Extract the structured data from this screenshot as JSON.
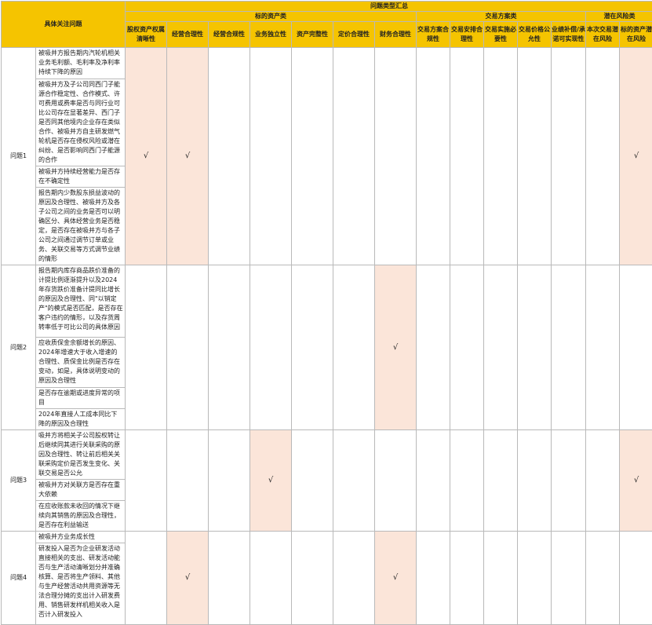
{
  "header": {
    "focus_issue": "具体关注问题",
    "summary": "问题类型汇总",
    "group_target_assets": "标的资产类",
    "group_transaction": "交易方案类",
    "group_risk": "潜在风险类"
  },
  "columns": [
    {
      "label": "股权资产权属清晰性",
      "group": "标的资产类"
    },
    {
      "label": "经营合理性",
      "group": "标的资产类"
    },
    {
      "label": "经营合规性",
      "group": "标的资产类"
    },
    {
      "label": "业务独立性",
      "group": "标的资产类"
    },
    {
      "label": "资产完整性",
      "group": "标的资产类"
    },
    {
      "label": "定价合理性",
      "group": "标的资产类"
    },
    {
      "label": "财务合理性",
      "group": "标的资产类"
    },
    {
      "label": "交易方案合规性",
      "group": "交易方案类"
    },
    {
      "label": "交易安排合理性",
      "group": "交易方案类"
    },
    {
      "label": "交易实施必要性",
      "group": "交易方案类"
    },
    {
      "label": "交易价格公允性",
      "group": "交易方案类"
    },
    {
      "label": "业绩补偿/承诺可实现性",
      "group": "交易方案类"
    },
    {
      "label": "本次交易潜在风险",
      "group": "潜在风险类"
    },
    {
      "label": "标的资产潜在风险",
      "group": "潜在风险类"
    }
  ],
  "check_mark": "√",
  "questions": [
    {
      "label": "问题1",
      "issues": [
        "被吸并方报告期内汽轮机相关业务毛利额、毛利率及净利率持续下降的原因",
        "被吸并方及子公司同西门子能源合作稳定性、合作模式、许可费用或费率是否与同行业可比公司存在显著差异、西门子是否同其他境内企业存在类似合作、被吸并方自主研发燃气轮机是否存在侵权风险或潜在纠纷、是否影响同西门子能源的合作",
        "被吸并方持续经营能力是否存在不确定性",
        "报告期内少数股东损益波动的原因及合理性、被吸并方及各子公司之间的业务是否可以明确区分、具体经营业务是否稳定，是否存在被吸并方与各子公司之间通过调节订单或业务、关联交易等方式调节业绩的情形"
      ],
      "checked": [
        0,
        1,
        13
      ]
    },
    {
      "label": "问题2",
      "issues": [
        "报告期内库存商品跌价准备的计提比例逐渐提升以及2024年存货跌价准备计提同比增长的原因及合理性、同\"以销定产\"的模式是否匹配，是否存在客户违约的情形，以及存货周转率低于可比公司的具体原因",
        "应收质保金余额增长的原因、2024年增速大于收入增速的合理性、质保金比例是否存在变动，如是，具体说明变动的原因及合理性",
        "是否存在逾期或进度异常的项目",
        "2024年直接人工成本同比下降的原因及合理性"
      ],
      "checked": [
        6
      ]
    },
    {
      "label": "问题3",
      "issues": [
        "吸并方将相关子公司股权转让后继续同其进行关联采购的原因及合理性、转让前后相关关联采购定价是否发生变化、关联交易是否公允",
        "被吸并方对关联方是否存在重大依赖",
        "在应收账款未收回的情况下继续向其销售的原因及合理性，是否存在利益输送"
      ],
      "checked": [
        3,
        13
      ]
    },
    {
      "label": "问题4",
      "issues": [
        "被吸并方业务成长性",
        "研发投入是否为企业研发活动直接相关的支出、研发活动能否与生产活动清晰划分并准确核算、是否将生产领料、其他与生产经营活动共用资源等无法合理分摊的支出计入研发费用、销售研发样机相关收入是否计入研发投入"
      ],
      "checked": [
        1,
        6
      ]
    }
  ]
}
